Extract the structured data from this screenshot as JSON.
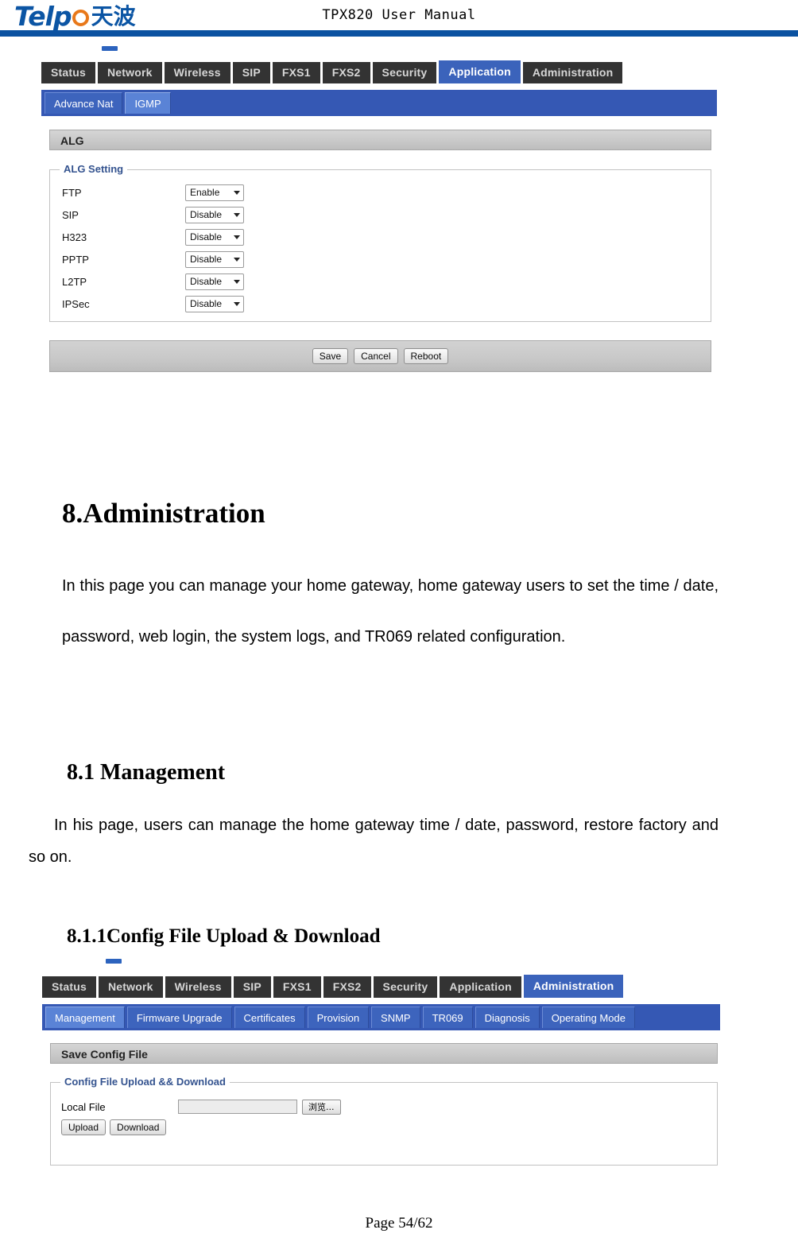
{
  "header": {
    "logo_word": "Telp",
    "logo_cn": "天波",
    "doc_title": "TPX820 User Manual"
  },
  "screenshot_application": {
    "tabs": [
      {
        "label": "Status",
        "active": false
      },
      {
        "label": "Network",
        "active": false
      },
      {
        "label": "Wireless",
        "active": false
      },
      {
        "label": "SIP",
        "active": false
      },
      {
        "label": "FXS1",
        "active": false
      },
      {
        "label": "FXS2",
        "active": false
      },
      {
        "label": "Security",
        "active": false
      },
      {
        "label": "Application",
        "active": true
      },
      {
        "label": "Administration",
        "active": false
      }
    ],
    "subtabs": [
      {
        "label": "Advance Nat",
        "active": false
      },
      {
        "label": "IGMP",
        "active": true
      }
    ],
    "panel_title": "ALG",
    "group_legend": "ALG Setting",
    "settings": [
      {
        "label": "FTP",
        "value": "Enable"
      },
      {
        "label": "SIP",
        "value": "Disable"
      },
      {
        "label": "H323",
        "value": "Disable"
      },
      {
        "label": "PPTP",
        "value": "Disable"
      },
      {
        "label": "L2TP",
        "value": "Disable"
      },
      {
        "label": "IPSec",
        "value": "Disable"
      }
    ],
    "buttons": [
      {
        "label": "Save"
      },
      {
        "label": "Cancel"
      },
      {
        "label": "Reboot"
      }
    ]
  },
  "doc": {
    "h1": "8.Administration",
    "intro": "In this page you can manage your home gateway, home gateway users to set the time / date, password, web login, the system logs, and TR069 related configuration.",
    "h2": "8.1 Management",
    "section_para": "In his page, users can manage the home gateway time / date, password, restore factory and so on.",
    "h3": "8.1.1Config File Upload & Download"
  },
  "screenshot_administration": {
    "tabs": [
      {
        "label": "Status",
        "active": false
      },
      {
        "label": "Network",
        "active": false
      },
      {
        "label": "Wireless",
        "active": false
      },
      {
        "label": "SIP",
        "active": false
      },
      {
        "label": "FXS1",
        "active": false
      },
      {
        "label": "FXS2",
        "active": false
      },
      {
        "label": "Security",
        "active": false
      },
      {
        "label": "Application",
        "active": false
      },
      {
        "label": "Administration",
        "active": true
      }
    ],
    "subtabs": [
      {
        "label": "Management",
        "active": true
      },
      {
        "label": "Firmware Upgrade",
        "active": false
      },
      {
        "label": "Certificates",
        "active": false
      },
      {
        "label": "Provision",
        "active": false
      },
      {
        "label": "SNMP",
        "active": false
      },
      {
        "label": "TR069",
        "active": false
      },
      {
        "label": "Diagnosis",
        "active": false
      },
      {
        "label": "Operating Mode",
        "active": false
      }
    ],
    "panel_title": "Save Config File",
    "group_legend": "Config File Upload && Download",
    "local_file_label": "Local File",
    "local_file_value": "",
    "browse_label": "浏览...",
    "upload_label": "Upload",
    "download_label": "Download"
  },
  "footer": {
    "page_label": "Page 54/62"
  },
  "colors": {
    "brand_blue": "#0b52a1",
    "brand_orange": "#e8781a",
    "tab_dark": "#333333",
    "tab_active_blue": "#3b63bb",
    "subnav_blue": "#3558b4",
    "legend_blue": "#34538f"
  }
}
